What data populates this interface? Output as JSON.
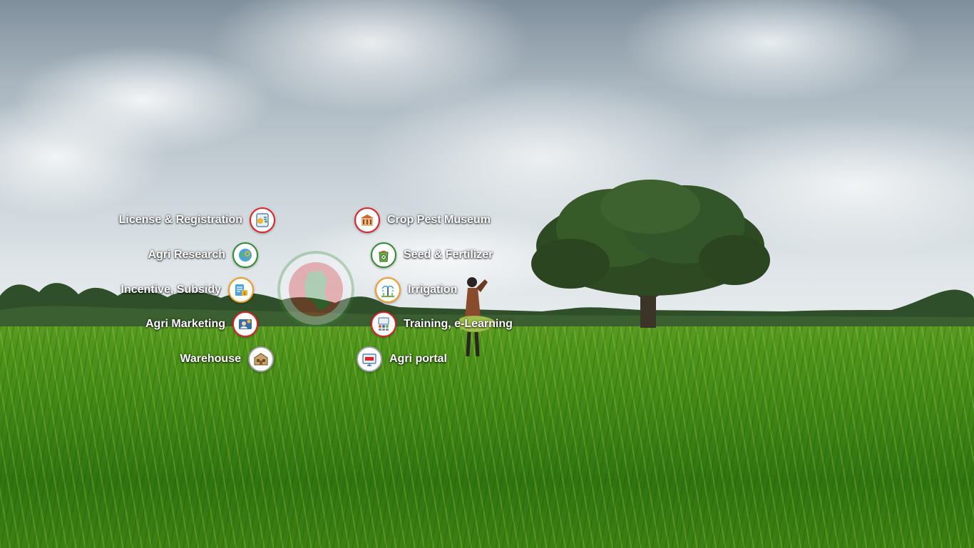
{
  "services_left": [
    {
      "label": "License & Registration",
      "icon": "license-registration-icon"
    },
    {
      "label": "Agri Research",
      "icon": "agri-research-icon"
    },
    {
      "label": "Incentive, Subsidy",
      "icon": "incentive-subsidy-icon"
    },
    {
      "label": "Agri Marketing",
      "icon": "agri-marketing-icon"
    },
    {
      "label": "Warehouse",
      "icon": "warehouse-icon"
    }
  ],
  "services_right": [
    {
      "label": "Crop Pest Museum",
      "icon": "crop-pest-museum-icon"
    },
    {
      "label": "Seed & Fertilizer",
      "icon": "seed-fertilizer-icon"
    },
    {
      "label": "Irrigation",
      "icon": "irrigation-icon"
    },
    {
      "label": "Training, e-Learning",
      "icon": "training-elearning-icon"
    },
    {
      "label": "Agri portal",
      "icon": "agri-portal-icon"
    }
  ],
  "colors": {
    "label_text": "#ffffff",
    "ring_red": "#e21f26",
    "ring_green": "#2e8b2e",
    "ring_orange": "#f29a21"
  }
}
